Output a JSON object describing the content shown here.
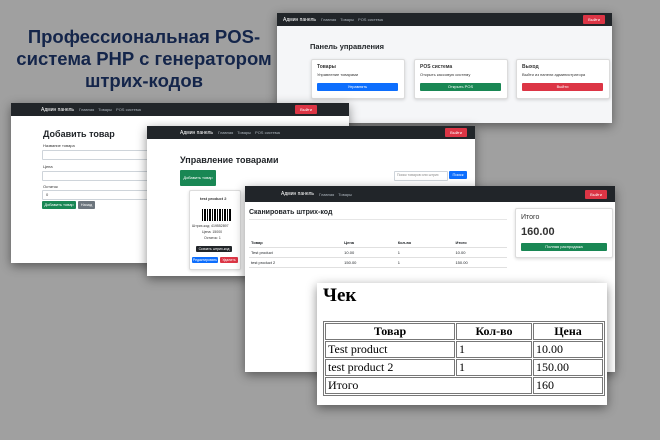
{
  "headline": {
    "line1": "Профессиональная POS-",
    "line2": "система PHP с генератором",
    "line3": "штрих-кодов"
  },
  "nav": {
    "brand": "Админ панель",
    "link_home": "Главная",
    "link_products": "Товары",
    "link_pos": "POS система",
    "logout": "Выйти"
  },
  "dashboard": {
    "title": "Панель управления",
    "cards": [
      {
        "title": "Товары",
        "text": "Управление товарами",
        "button": "Управлять"
      },
      {
        "title": "POS система",
        "text": "Открыть кассовую систему",
        "button": "Открыть POS"
      },
      {
        "title": "Выход",
        "text": "Выйти из панели администратора",
        "button": "Выйти"
      }
    ]
  },
  "add_product": {
    "title": "Добавить товар",
    "name_label": "Название товара",
    "price_label": "Цена",
    "stock_label": "Остаток",
    "stock_value": "0",
    "submit": "Добавить товар",
    "back": "Назад"
  },
  "manage": {
    "title": "Управление товарами",
    "add_button": "Добавить товар",
    "search_placeholder": "Поиск товаров или штрих",
    "search_button": "Поиск",
    "product": {
      "name": "test product 2",
      "barcode_label": "Штрих-код: 419552897",
      "price_label": "Цена: 15000",
      "stock_label": "Остаток: 1",
      "barcode_button": "Скачать штрих-код",
      "edit": "Редактировать",
      "delete": "Удалить"
    }
  },
  "pos": {
    "title": "Сканировать штрих-код",
    "headers": [
      "Товар",
      "Цена",
      "Кол-во",
      "Итого"
    ],
    "rows": [
      [
        "Test product",
        "10.00",
        "1",
        "10.00"
      ],
      [
        "test product 2",
        "150.00",
        "1",
        "150.00"
      ]
    ],
    "total_title": "Итого",
    "total_value": "160.00",
    "complete": "Полная распродажа"
  },
  "receipt": {
    "title": "Чек",
    "headers": [
      "Товар",
      "Кол-во",
      "Цена"
    ],
    "rows": [
      [
        "Test product",
        "1",
        "10.00"
      ],
      [
        "test product 2",
        "1",
        "150.00"
      ]
    ],
    "total_label": "Итого",
    "total_value": "160"
  }
}
